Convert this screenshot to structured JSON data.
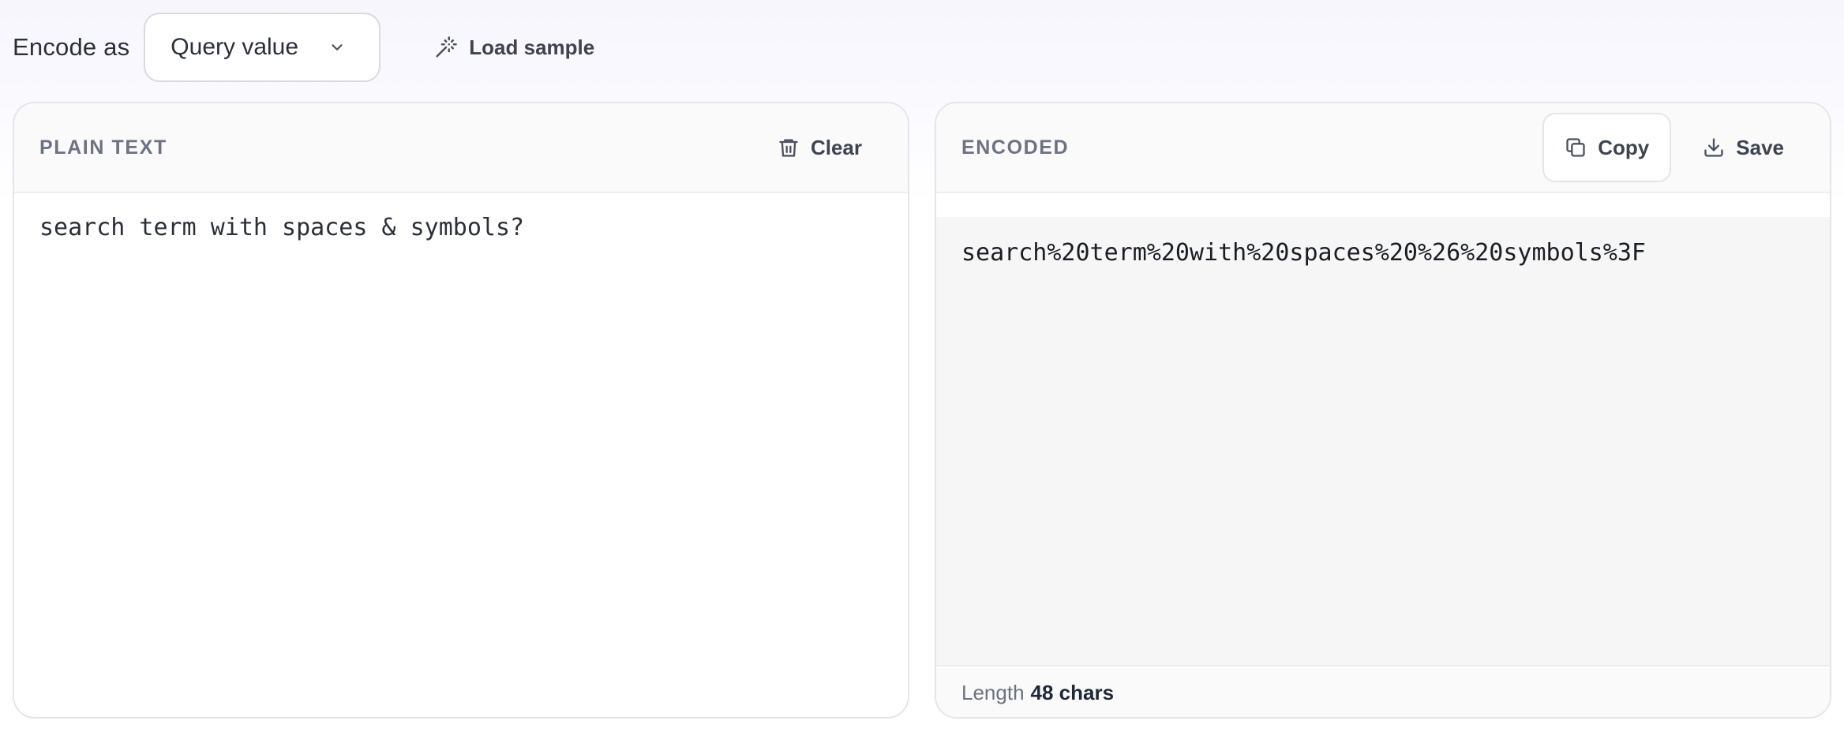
{
  "toolbar": {
    "encode_label": "Encode as",
    "mode_select": {
      "value": "Query value",
      "icon": "chevron-down-icon"
    },
    "load_sample": {
      "label": "Load sample",
      "icon": "magic-wand-icon"
    }
  },
  "input_panel": {
    "title": "PLAIN TEXT",
    "clear": {
      "label": "Clear",
      "icon": "trash-icon"
    },
    "text": "search term with spaces & symbols?"
  },
  "output_panel": {
    "title": "ENCODED",
    "copy": {
      "label": "Copy",
      "icon": "copy-icon"
    },
    "save": {
      "label": "Save",
      "icon": "download-icon"
    },
    "text": "search%20term%20with%20spaces%20%26%20symbols%3F",
    "length_label": "Length",
    "length_value": "48 chars"
  },
  "colors": {
    "text_primary": "#1f2937",
    "text_muted": "#6b7280",
    "border": "#e4e5ea",
    "output_bg": "#f6f6f6"
  }
}
